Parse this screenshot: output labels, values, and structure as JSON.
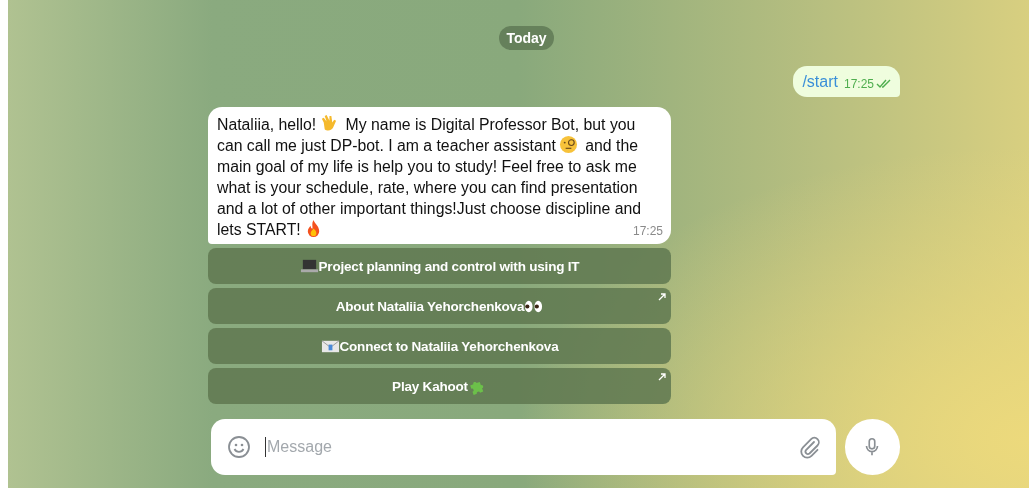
{
  "date_chip": "Today",
  "outgoing": {
    "text": "/start",
    "time": "17:25",
    "read": true
  },
  "incoming": {
    "parts": [
      "Nataliia, hello!",
      " My name is Digital Professor Bot, but you can call me just DP-bot. I am a teacher assistant",
      " and the main goal of my life is help you to study! Feel free to ask me what is your schedule, rate, where you can find presentation and a lot of other important things!Just choose discipline and lets START!"
    ],
    "time": "17:25"
  },
  "buttons": [
    {
      "label": "Project planning and control with using IT",
      "link": false
    },
    {
      "label": "About Nataliia Yehorchenkova",
      "link": true
    },
    {
      "label": "Connect to Nataliia Yehorchenkova",
      "link": false
    },
    {
      "label": "Play Kahoot",
      "link": true
    }
  ],
  "composer": {
    "placeholder": "Message"
  }
}
